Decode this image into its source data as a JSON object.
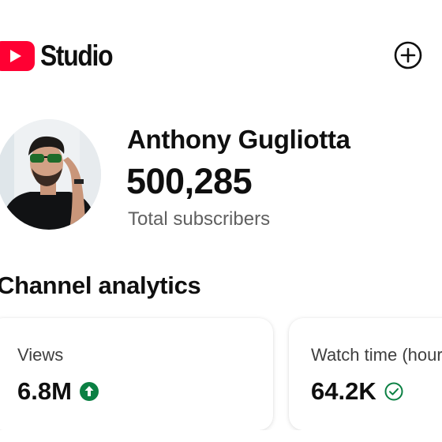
{
  "header": {
    "logo_text": "Studio",
    "add_button_label": "Create"
  },
  "channel": {
    "name": "Anthony Gugliotta",
    "subscriber_count": "500,285",
    "subscriber_label": "Total subscribers"
  },
  "analytics": {
    "section_title": "Channel analytics",
    "cards": [
      {
        "label": "Views",
        "value": "6.8M",
        "status_icon": "arrow-up-circle-icon"
      },
      {
        "label": "Watch time (hour",
        "value": "64.2K",
        "status_icon": "check-circle-icon"
      }
    ]
  },
  "colors": {
    "brand_red": "#ff0033",
    "positive_green": "#0b8043",
    "text_primary": "#0f0f0f",
    "text_secondary": "#606060"
  }
}
